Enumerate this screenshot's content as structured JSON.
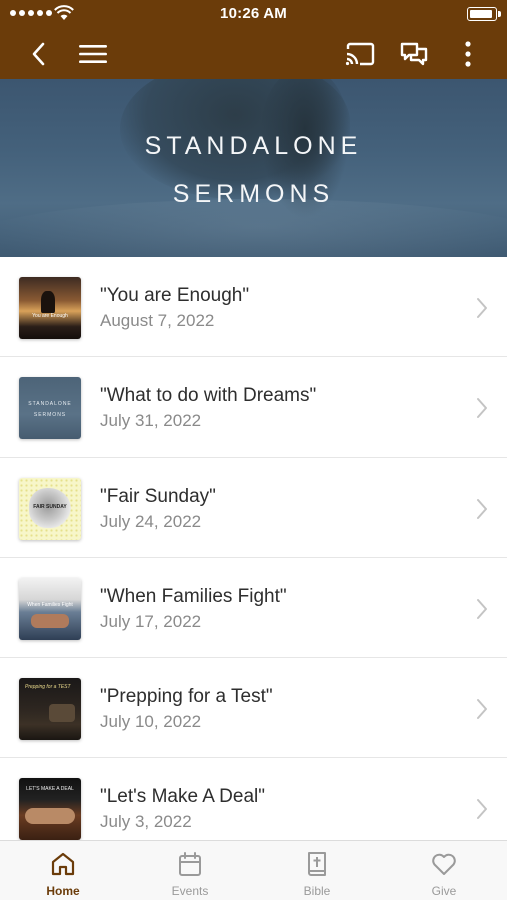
{
  "status_bar": {
    "time": "10:26 AM",
    "battery_level": 0.95
  },
  "nav_bar": {
    "back_icon": "chevron-left-icon",
    "menu_icon": "hamburger-menu-icon",
    "cast_icon": "cast-icon",
    "chat_icon": "chat-icon",
    "more_icon": "more-vertical-icon"
  },
  "hero": {
    "title_line1": "STANDALONE",
    "title_line2": "SERMONS"
  },
  "sermons": [
    {
      "title": "\"You are Enough\"",
      "date": "August 7, 2022",
      "thumb_text": "You are Enough"
    },
    {
      "title": "\"What to do with Dreams\"",
      "date": "July 31, 2022",
      "thumb_text_1": "STANDALONE",
      "thumb_text_2": "SERMONS"
    },
    {
      "title": "\"Fair Sunday\"",
      "date": "July 24, 2022",
      "thumb_text": "FAIR SUNDAY"
    },
    {
      "title": "\"When Families Fight\"",
      "date": "July 17, 2022",
      "thumb_text": "When Families Fight"
    },
    {
      "title": "\"Prepping for a Test\"",
      "date": "July 10, 2022",
      "thumb_text": "Prepping for a TEST"
    },
    {
      "title": "\"Let's Make A Deal\"",
      "date": "July 3, 2022",
      "thumb_text": "LET'S MAKE A DEAL"
    }
  ],
  "tab_bar": {
    "tabs": [
      {
        "label": "Home",
        "icon": "home-icon",
        "active": true
      },
      {
        "label": "Events",
        "icon": "calendar-icon",
        "active": false
      },
      {
        "label": "Bible",
        "icon": "bible-icon",
        "active": false
      },
      {
        "label": "Give",
        "icon": "heart-icon",
        "active": false
      }
    ]
  },
  "colors": {
    "brand": "#6b3c0a",
    "inactive_tab": "#9a9a9a",
    "chevron": "#c4c4c4"
  }
}
